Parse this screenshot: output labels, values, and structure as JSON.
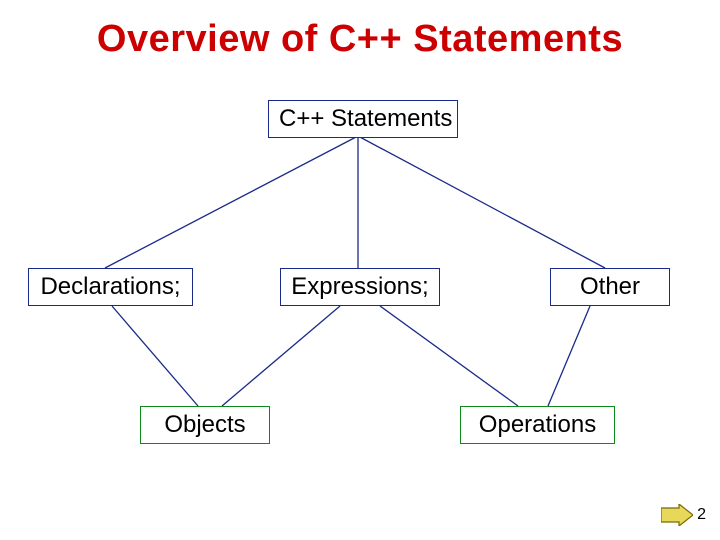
{
  "title": "Overview of C++ Statements",
  "nodes": {
    "root": "C++ Statements",
    "declarations": "Declarations;",
    "expressions": "Expressions;",
    "other": "Other",
    "objects": "Objects",
    "operations": "Operations"
  },
  "page_number": "2"
}
